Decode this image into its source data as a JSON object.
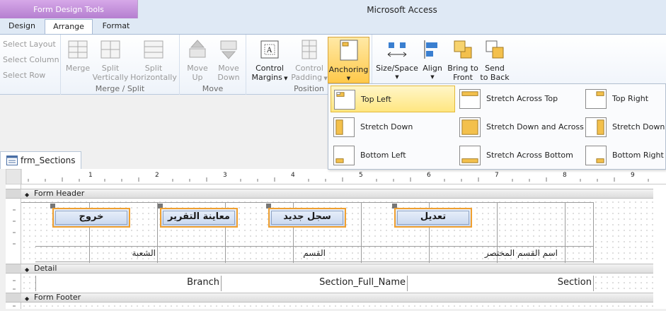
{
  "title_bar": {
    "tools_title": "Form Design Tools",
    "app_title": "Microsoft Access"
  },
  "tabs": [
    {
      "label": "Design"
    },
    {
      "label": "Arrange"
    },
    {
      "label": "Format"
    }
  ],
  "ribbon": {
    "rows_group": {
      "items": [
        "Select Layout",
        "Select Column",
        "Select Row"
      ]
    },
    "merge_split": {
      "label": "Merge / Split",
      "merge": "Merge",
      "split_v": [
        "Split",
        "Vertically"
      ],
      "split_h": [
        "Split",
        "Horizontally"
      ]
    },
    "move": {
      "label": "Move",
      "up": [
        "Move",
        "Up"
      ],
      "down": [
        "Move",
        "Down"
      ]
    },
    "position": {
      "label": "Position",
      "control_margins": [
        "Control",
        "Margins"
      ],
      "control_padding": [
        "Control",
        "Padding"
      ],
      "anchoring": "Anchoring"
    },
    "sizing": {
      "size_space": "Size/Space",
      "align": "Align",
      "bring_to_front": [
        "Bring to",
        "Front"
      ],
      "send_to_back": [
        "Send",
        "to Back"
      ]
    }
  },
  "anchoring_menu": {
    "options": [
      {
        "label": "Top Left",
        "selected": true
      },
      {
        "label": "Stretch Across Top"
      },
      {
        "label": "Top Right"
      },
      {
        "label": "Stretch Down"
      },
      {
        "label": "Stretch Down and Across"
      },
      {
        "label": "Stretch Down a"
      },
      {
        "label": "Bottom Left"
      },
      {
        "label": "Stretch Across Bottom"
      },
      {
        "label": "Bottom Right"
      }
    ]
  },
  "document": {
    "tab_title": "frm_Sections",
    "ruler_numbers": [
      "1",
      "2",
      "3",
      "4",
      "5",
      "6",
      "7",
      "8",
      "9"
    ],
    "sections": {
      "header": "Form Header",
      "detail": "Detail",
      "footer": "Form Footer"
    },
    "header_buttons": [
      "خروج",
      "معاينة التقرير",
      "سجل جديد",
      "تعديل"
    ],
    "column_labels": [
      "الشعبة",
      "القسم",
      "اسم القسم المختصر"
    ],
    "detail_fields": [
      "Branch",
      "Section_Full_Name",
      "Section"
    ]
  },
  "colors": {
    "selection_border": "#f0a030",
    "tools_tab": "#c38fd8",
    "menu_highlight": "#ffe680"
  }
}
